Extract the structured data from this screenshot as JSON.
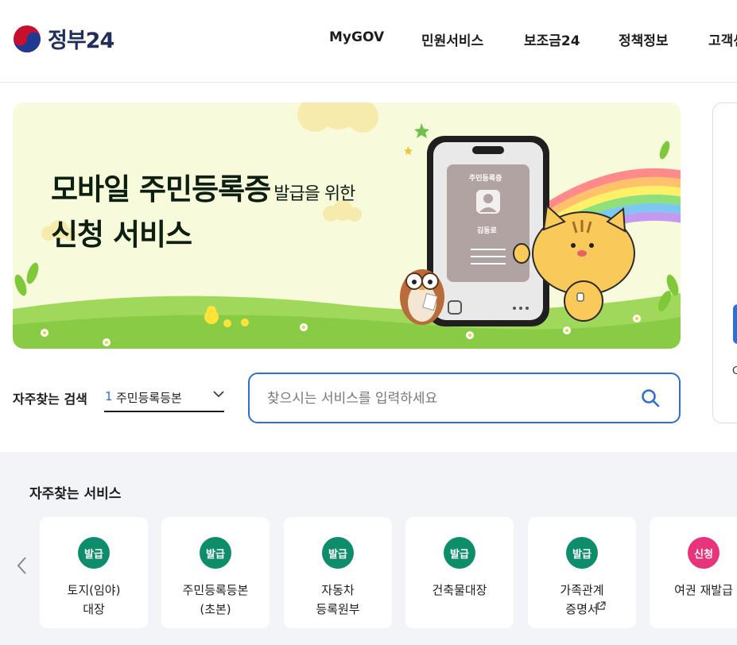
{
  "header": {
    "logo_text": "정부24",
    "nav": [
      "MyGOV",
      "민원서비스",
      "보조금24",
      "정책정보",
      "고객센터"
    ]
  },
  "banner": {
    "title_main": "모바일 주민등록증",
    "title_small": "발급을 위한",
    "title_line2": "신청 서비스",
    "card_title": "주민등록증",
    "card_name": "김동로"
  },
  "side": {
    "text": "C"
  },
  "frequent_search": {
    "label": "자주찾는 검색",
    "rank": "1",
    "value": "주민등록등본"
  },
  "search": {
    "placeholder": "찾으시는 서비스를 입력하세요"
  },
  "services": {
    "title": "자주찾는 서비스",
    "items": [
      {
        "badge": "발급",
        "label": "토지(임야)\n대장",
        "color": "#0e8d6a"
      },
      {
        "badge": "발급",
        "label": "주민등록등본\n(초본)",
        "color": "#0e8d6a"
      },
      {
        "badge": "발급",
        "label": "자동차\n등록원부",
        "color": "#0e8d6a"
      },
      {
        "badge": "발급",
        "label": "건축물대장",
        "color": "#0e8d6a"
      },
      {
        "badge": "발급",
        "label": "가족관계\n증명서",
        "color": "#0e8d6a"
      },
      {
        "badge": "신청",
        "label": "여권 재발급",
        "color": "#e8347a"
      }
    ]
  }
}
